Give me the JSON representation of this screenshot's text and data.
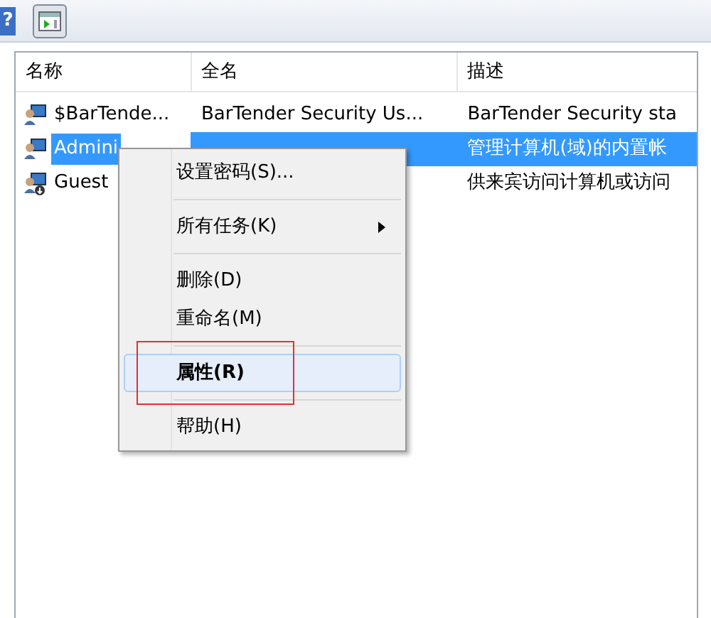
{
  "toolbar": {
    "help_glyph": "?"
  },
  "list": {
    "columns": [
      "名称",
      "全名",
      "描述"
    ],
    "rows": [
      {
        "kind": "user",
        "selected": false,
        "cells": [
          "$BarTende...",
          "BarTender Security Us...",
          "BarTender Security sta"
        ]
      },
      {
        "kind": "admin",
        "selected": true,
        "cells": [
          "Admini",
          "",
          "管理计算机(域)的内置帐"
        ]
      },
      {
        "kind": "guest",
        "selected": false,
        "cells": [
          "Guest",
          "",
          "供来宾访问计算机或访问"
        ]
      }
    ]
  },
  "context_menu": {
    "items": [
      {
        "kind": "item",
        "label": "设置密码(S)...",
        "submenu": false,
        "selected": false,
        "bold": false
      },
      {
        "kind": "separator"
      },
      {
        "kind": "item",
        "label": "所有任务(K)",
        "submenu": true,
        "selected": false,
        "bold": false
      },
      {
        "kind": "separator"
      },
      {
        "kind": "item",
        "label": "删除(D)",
        "submenu": false,
        "selected": false,
        "bold": false
      },
      {
        "kind": "item",
        "label": "重命名(M)",
        "submenu": false,
        "selected": false,
        "bold": false
      },
      {
        "kind": "separator"
      },
      {
        "kind": "item",
        "label": "属性(R)",
        "submenu": false,
        "selected": true,
        "bold": true
      },
      {
        "kind": "separator"
      },
      {
        "kind": "item",
        "label": "帮助(H)",
        "submenu": false,
        "selected": false,
        "bold": false
      }
    ]
  }
}
